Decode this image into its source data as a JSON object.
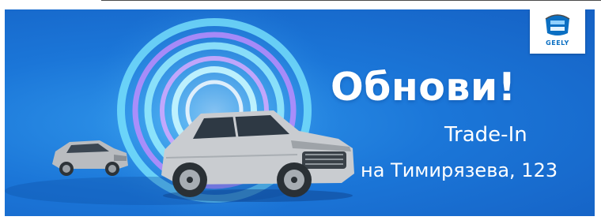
{
  "brand": {
    "logo_text": "GEELY",
    "colors": {
      "banner_blue": "#1b76d8",
      "ring_cyan": "#7fe9ff",
      "ring_violet": "#c58cff",
      "logo_blue": "#0b6fc2",
      "text": "#ffffff"
    }
  },
  "banner": {
    "headline": "Обнови!",
    "line1": "Trade-In",
    "line2": "на Тимирязева, 123"
  },
  "icons": {
    "logo": "geely-logo-icon",
    "car_main": "suv-car-icon",
    "car_back": "suv-car-icon"
  }
}
